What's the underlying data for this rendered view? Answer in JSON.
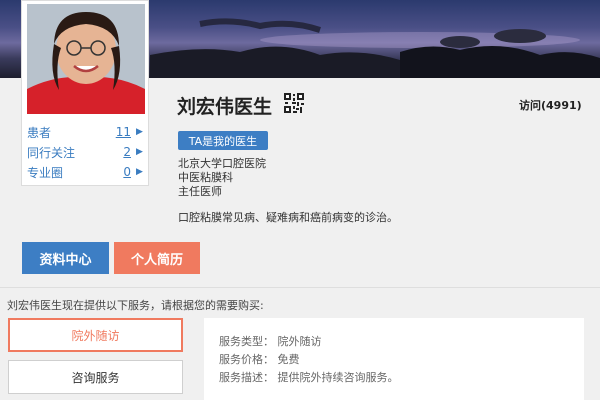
{
  "profile": {
    "stats": [
      {
        "label": "患者",
        "count": "11"
      },
      {
        "label": "同行关注",
        "count": "2"
      },
      {
        "label": "专业圈",
        "count": "0"
      }
    ]
  },
  "header": {
    "doctor_name": "刘宏伟医生",
    "visits": "访问(4991)"
  },
  "ta_button_label": "TA是我的医生",
  "info": {
    "hospital": "北京大学口腔医院",
    "department": "中医粘膜科",
    "title": "主任医师",
    "specialty": "口腔粘膜常见病、疑难病和癌前病变的诊治。"
  },
  "tabs": {
    "data_center": "资料中心",
    "resume": "个人简历"
  },
  "services": {
    "prompt": "刘宏伟医生现在提供以下服务，请根据您的需要购买:",
    "tabs": [
      "院外随访",
      "咨询服务"
    ],
    "detail": {
      "type": "服务类型： 院外随访",
      "price": "服务价格： 免费",
      "description": "服务描述： 提供院外持续咨询服务。"
    }
  },
  "colors": {
    "accent_blue": "#3d7ec4",
    "accent_orange": "#f07a5f"
  }
}
